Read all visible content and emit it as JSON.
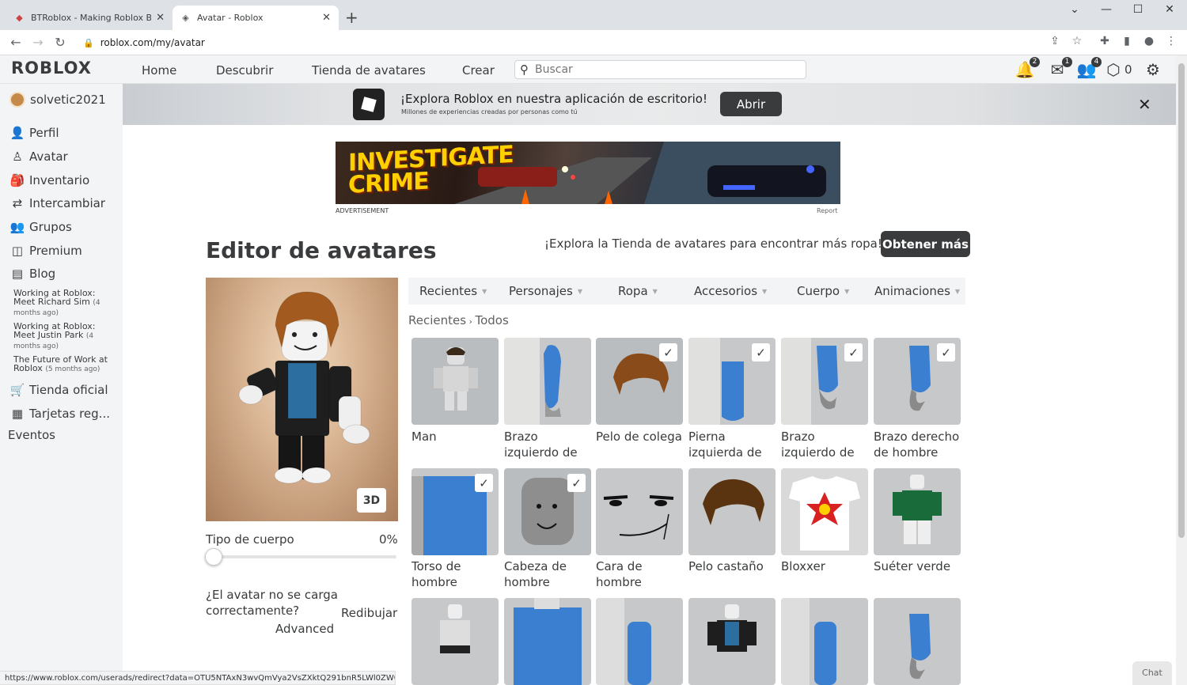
{
  "browser": {
    "tabs": [
      {
        "title": "BTRoblox - Making Roblox Bette"
      },
      {
        "title": "Avatar - Roblox"
      }
    ],
    "url": "roblox.com/my/avatar",
    "status_url": "https://www.roblox.com/userads/redirect?data=OTU5NTAxN3wvQmVya2VsZXktQ291bnR5LWl0ZW0_SU..."
  },
  "header": {
    "logo": "ROBLOX",
    "nav": [
      "Home",
      "Descubrir",
      "Tienda de avatares",
      "Crear"
    ],
    "search_placeholder": "Buscar",
    "notifications_count": "2",
    "messages_count": "1",
    "friends_count": "4",
    "robux": "0"
  },
  "banner": {
    "title": "¡Explora Roblox en nuestra aplicación de escritorio!",
    "subtitle": "Millones de experiencias creadas por personas como tú",
    "button": "Abrir"
  },
  "sidebar": {
    "username": "solvetic2021",
    "items": [
      "Perfil",
      "Avatar",
      "Inventario",
      "Intercambiar",
      "Grupos",
      "Premium",
      "Blog"
    ],
    "blog_posts": [
      {
        "title": "Working at Roblox: Meet Richard Sim",
        "ago": "(4 months ago)"
      },
      {
        "title": "Working at Roblox: Meet Justin Park",
        "ago": "(4 months ago)"
      },
      {
        "title": "The Future of Work at Roblox",
        "ago": "(5 months ago)"
      }
    ],
    "items_bottom": [
      "Tienda oficial",
      "Tarjetas reg..."
    ],
    "eventos": "Eventos"
  },
  "ad": {
    "headline": "INVESTIGATE CRIME",
    "label": "ADVERTISEMENT",
    "report": "Report"
  },
  "editor": {
    "title": "Editor de avatares",
    "explore_text": "¡Explora la Tienda de avatares para encontrar más ropa!",
    "get_more": "Obtener más",
    "btn_3d": "3D",
    "body_type_label": "Tipo de cuerpo",
    "body_type_value": "0%",
    "body_type_fraction": 0,
    "not_loading": "¿El avatar no se carga correctamente?",
    "redraw": "Redibujar",
    "advanced": "Advanced",
    "categories": [
      "Recientes",
      "Personajes",
      "Ropa",
      "Accesorios",
      "Cuerpo",
      "Animaciones"
    ],
    "breadcrumb": "Recientes",
    "breadcrumb_current": "Todos",
    "items": [
      {
        "name": "Man",
        "line2": "",
        "checked": false
      },
      {
        "name": "Brazo",
        "line2": "izquierdo de",
        "checked": false
      },
      {
        "name": "Pelo de colega",
        "line2": "",
        "checked": true
      },
      {
        "name": "Pierna",
        "line2": "izquierda de",
        "checked": true
      },
      {
        "name": "Brazo",
        "line2": "izquierdo de",
        "checked": true
      },
      {
        "name": "Brazo derecho",
        "line2": "de hombre",
        "checked": true
      },
      {
        "name": "Torso de",
        "line2": "hombre",
        "checked": true
      },
      {
        "name": "Cabeza de",
        "line2": "hombre",
        "checked": true
      },
      {
        "name": "Cara de",
        "line2": "hombre",
        "checked": false
      },
      {
        "name": "Pelo castaño",
        "line2": "",
        "checked": false
      },
      {
        "name": "Bloxxer",
        "line2": "",
        "checked": false
      },
      {
        "name": "Suéter verde",
        "line2": "",
        "checked": false
      }
    ]
  },
  "chat_label": "Chat"
}
